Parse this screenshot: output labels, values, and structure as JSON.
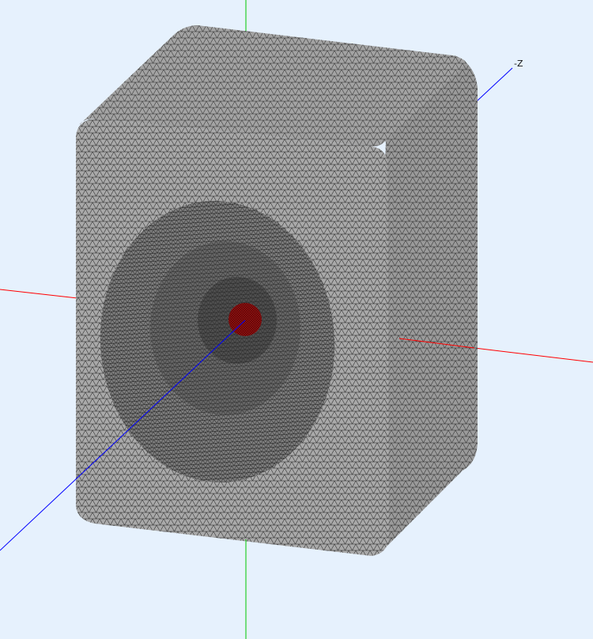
{
  "viewport": {
    "background": "#e6f1fd",
    "axis_label": "-Z"
  },
  "axes": {
    "x_color": "#ff0000",
    "y_color": "#00c800",
    "z_color": "#0000ff"
  },
  "mesh": {
    "object": "rounded-box-enclosure-with-spherical-cavity",
    "face_color": "#a7a7a7",
    "edge_color": "#1a1a1a",
    "highlight_color": "#8e1010"
  }
}
